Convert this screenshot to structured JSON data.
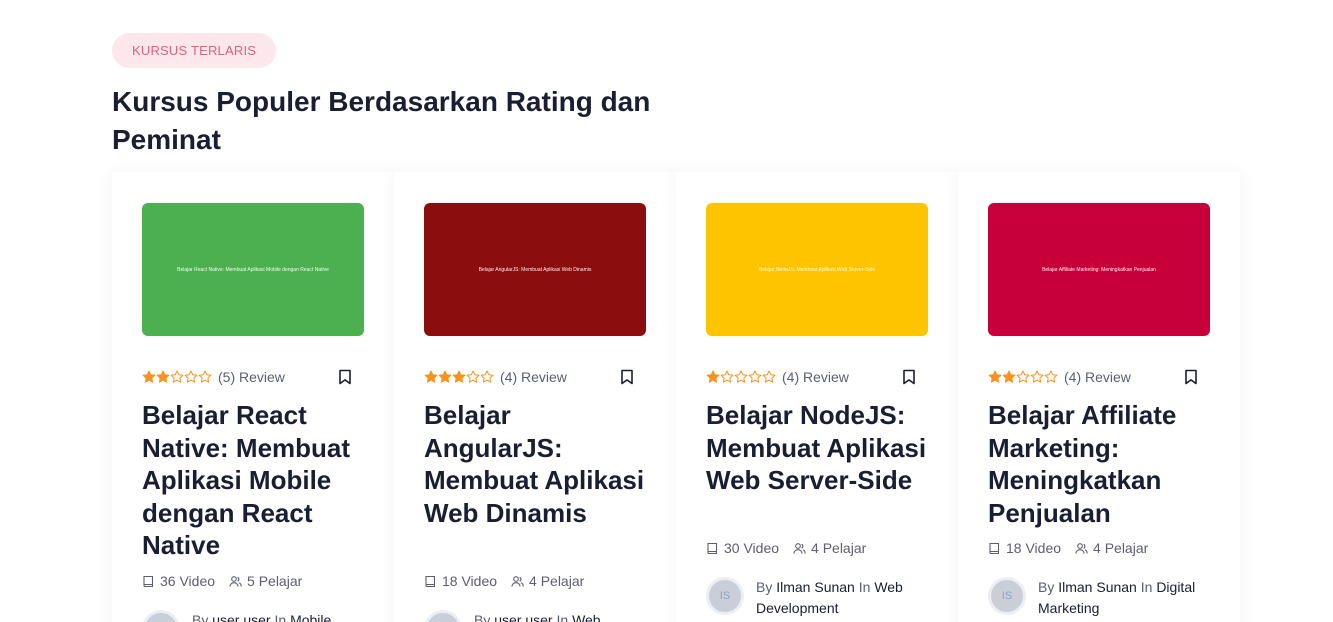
{
  "section": {
    "badge": "KURSUS TERLARIS",
    "heading": "Kursus Populer Berdasarkan Rating dan Peminat"
  },
  "colors": {
    "star": "#f7931e",
    "star_empty_stroke": "#f7931e",
    "badge_bg": "#fce7ec",
    "badge_text": "#e0607e"
  },
  "courses": [
    {
      "thumb_color": "#4caf50",
      "thumb_text": "Belajar React Native: Membuat Aplikasi Mobile dengan React Native",
      "rating": 2,
      "review": "(5) Review",
      "title": "Belajar React Native: Membuat Aplikasi Mobile dengan React Native",
      "videos": "36 Video",
      "students": "5 Pelajar",
      "by": "By",
      "author": "user user",
      "in": "In",
      "category": "Mobile",
      "avatar_initials": ""
    },
    {
      "thumb_color": "#8b0d0d",
      "thumb_text": "Belajar AngularJS: Membuat Aplikasi Web Dinamis",
      "rating": 3,
      "review": "(4) Review",
      "title": "Belajar AngularJS: Membuat Aplikasi Web Dinamis",
      "videos": "18 Video",
      "students": "4 Pelajar",
      "by": "By",
      "author": "user user",
      "in": "In",
      "category": "Web",
      "avatar_initials": ""
    },
    {
      "thumb_color": "#ffc400",
      "thumb_text": "Belajar NodeJS: Membuat Aplikasi Web Server-Side",
      "rating": 1,
      "review": "(4) Review",
      "title": "Belajar NodeJS: Membuat Aplikasi Web Server-Side",
      "videos": "30 Video",
      "students": "4 Pelajar",
      "by": "By",
      "author": "Ilman Sunan",
      "in": "In",
      "category": "Web Development",
      "avatar_initials": "IS"
    },
    {
      "thumb_color": "#c8003a",
      "thumb_text": "Belajar Affiliate Marketing: Meningkatkan Penjualan",
      "rating": 2,
      "review": "(4) Review",
      "title": "Belajar Affiliate Marketing: Meningkatkan Penjualan",
      "videos": "18 Video",
      "students": "4 Pelajar",
      "by": "By",
      "author": "Ilman Sunan",
      "in": "In",
      "category": "Digital Marketing",
      "avatar_initials": "IS"
    }
  ]
}
